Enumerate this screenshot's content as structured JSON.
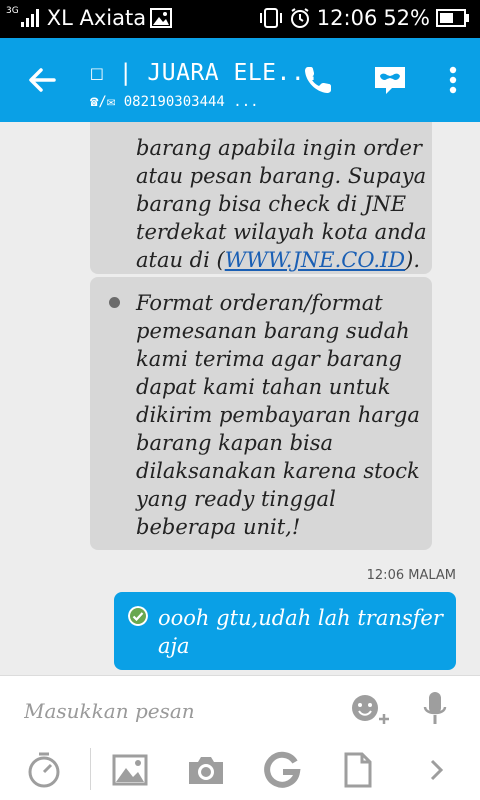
{
  "status_bar": {
    "network_type": "3G",
    "carrier": "XL Axiata",
    "time": "12:06",
    "battery": "52%"
  },
  "app_bar": {
    "title": "☐ | JUARA ELE...",
    "subtitle": "☎/✉ 082190303444 ..."
  },
  "messages": {
    "incoming_1": {
      "lines": [
        "barang apabila ingin order",
        "atau pesan barang. Supaya",
        "barang bisa check di JNE",
        "terdekat wilayah kota anda"
      ],
      "last_prefix": "atau di (",
      "link": "WWW.JNE.CO.ID",
      "last_suffix": ")."
    },
    "incoming_2": {
      "lines": [
        "Format orderan/format",
        "pemesanan barang sudah",
        "kami terima agar barang",
        "dapat kami tahan untuk",
        "dikirim pembayaran harga",
        "barang kapan bisa",
        "dilaksanakan karena stock",
        "yang ready tinggal",
        "beberapa unit,!"
      ]
    },
    "timestamp": "12:06 MALAM",
    "outgoing_1": {
      "lines": [
        "oooh gtu,udah lah transfer",
        "aja"
      ]
    }
  },
  "composer": {
    "placeholder": "Masukkan pesan"
  },
  "colors": {
    "accent": "#0aa0e6",
    "incoming_bubble": "#d7d7d7",
    "background": "#ededed"
  }
}
